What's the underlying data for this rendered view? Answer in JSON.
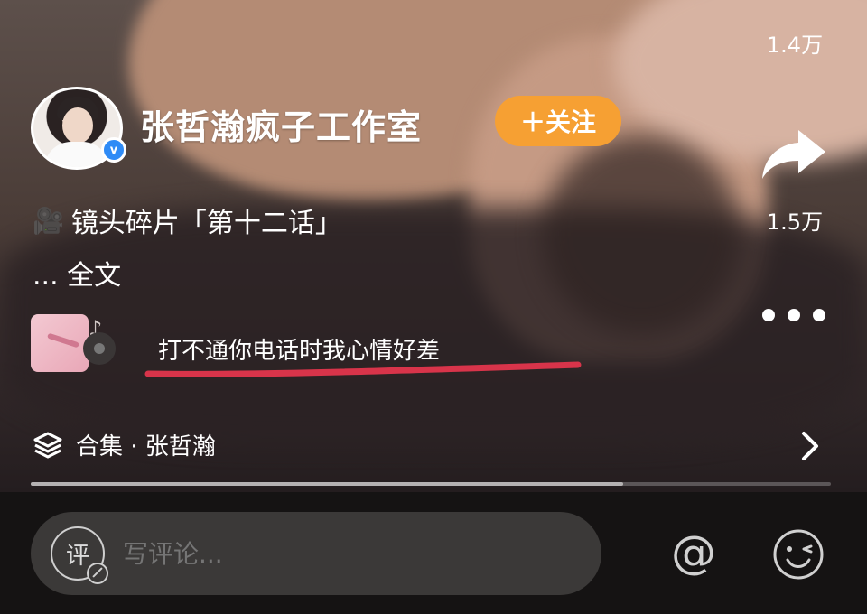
{
  "author": {
    "name": "张哲瀚疯子工作室",
    "verified_mark": "v",
    "follow_label": "＋关注"
  },
  "post": {
    "caption_icon": "movie-camera-icon",
    "caption": "镜头碎片「第十二话」",
    "expand_label": "... 全文"
  },
  "music": {
    "song_title": "打不通你电话时我心情好差",
    "underline_color": "#d8344a"
  },
  "actions": {
    "like_count": "1.4万",
    "share_count": "1.5万",
    "more_icon": "more-dots-icon"
  },
  "collection": {
    "label": "合集 · 张哲瀚",
    "icon": "layers-icon"
  },
  "progress": {
    "fraction": 0.74
  },
  "comment_bar": {
    "badge_char": "评",
    "placeholder": "写评论...",
    "at_symbol": "@"
  },
  "colors": {
    "follow_button": "#f6a033",
    "verified_badge": "#2f8bf6"
  }
}
